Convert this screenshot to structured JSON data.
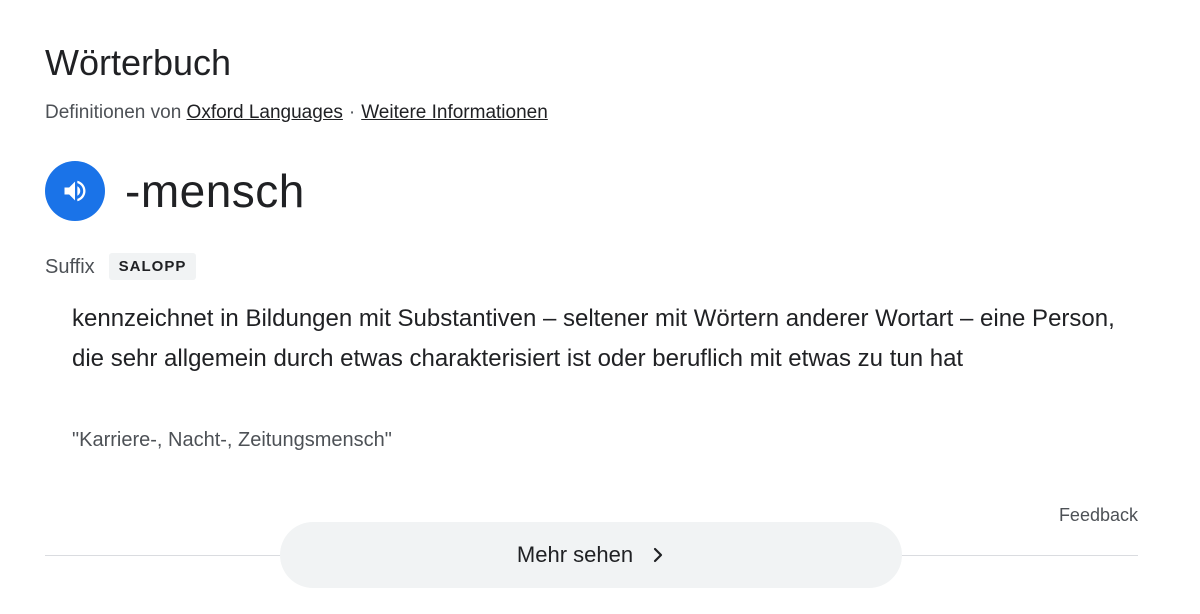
{
  "panel": {
    "title": "Wörterbuch",
    "attribution_prefix": "Definitionen von",
    "source_link": "Oxford Languages",
    "separator": "·",
    "more_info_link": "Weitere Informationen"
  },
  "entry": {
    "headword": "-mensch",
    "audio_icon": "speaker-icon",
    "part_of_speech": "Suffix",
    "register_label": "SALOPP",
    "definition": "kennzeichnet in Bildungen mit Substantiven – seltener mit Wörtern anderer Wortart – eine Person, die sehr allgemein durch etwas charakterisiert ist oder beruflich mit etwas zu tun hat",
    "example": "\"Karriere-, Nacht-, Zeitungsmensch\""
  },
  "footer": {
    "feedback_label": "Feedback",
    "more_button_label": "Mehr sehen",
    "more_button_icon": "chevron-right-icon"
  },
  "colors": {
    "accent": "#1a73e8",
    "text_primary": "#202124",
    "text_secondary": "#4d5156",
    "pill_background": "#f1f3f4",
    "divider": "#dadce0"
  }
}
